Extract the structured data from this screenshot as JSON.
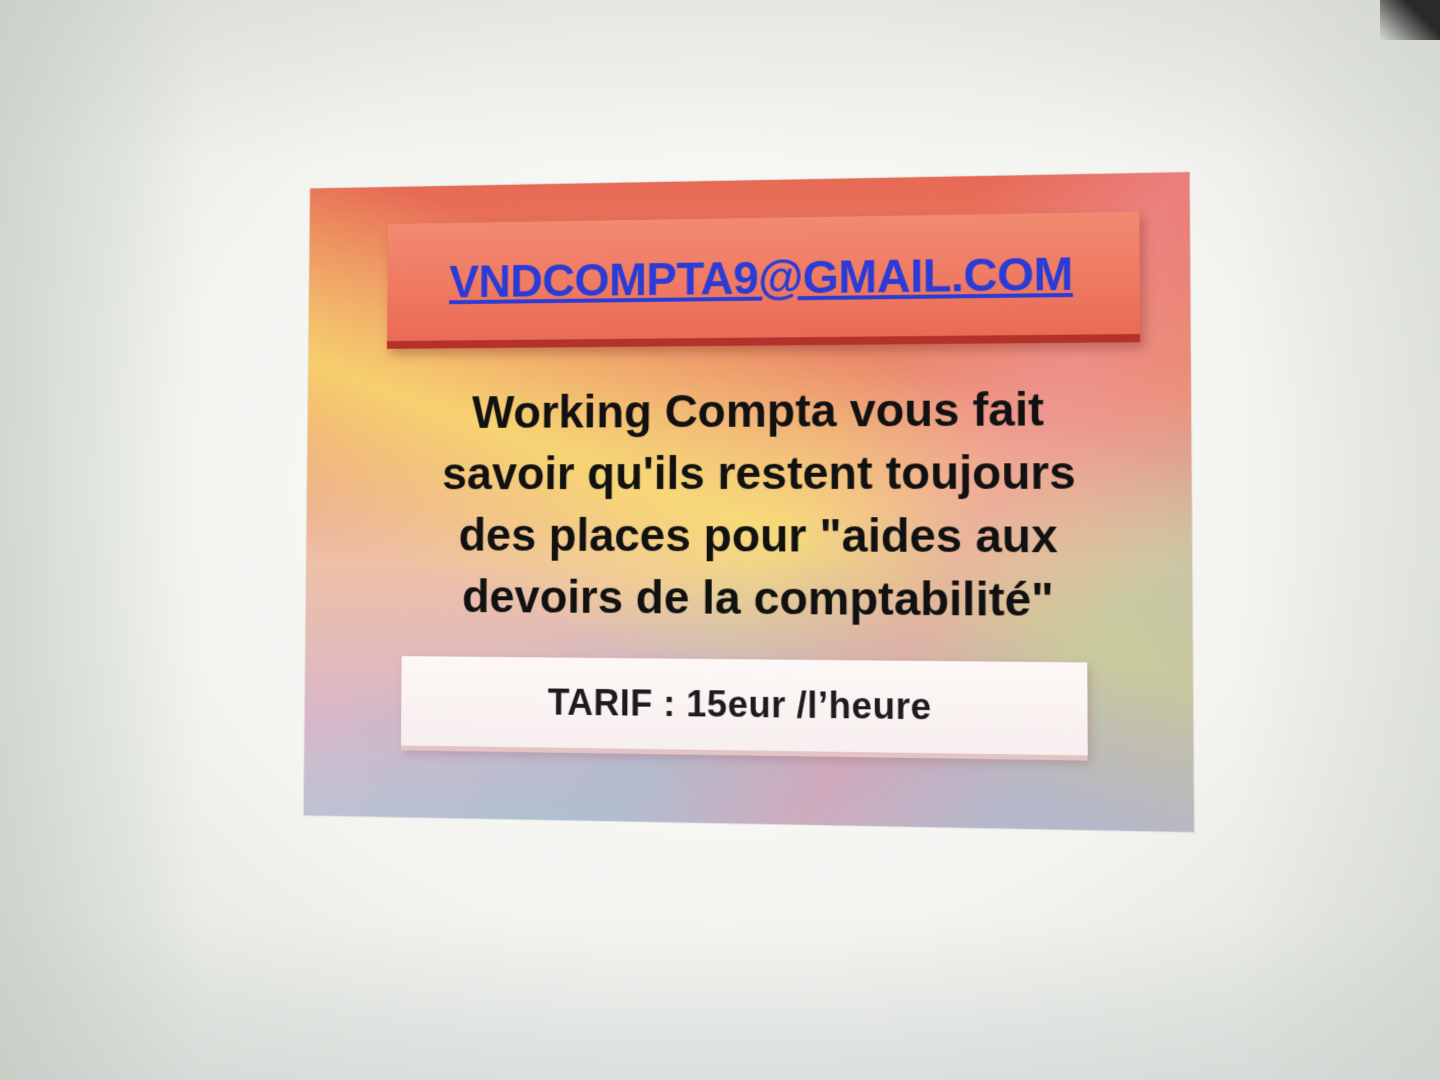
{
  "flyer": {
    "email": "VNDCOMPTA9@GMAIL.COM",
    "message_lines": [
      "Working Compta vous fait",
      "savoir qu'ils restent toujours",
      "des places pour \"aides aux",
      "devoirs de la comptabilité\""
    ],
    "tarif": "TARIF : 15eur /l’heure"
  },
  "colors": {
    "email_text": "#2a3bd6",
    "email_box": "#f07b63",
    "email_box_border": "#b5322a",
    "message_text": "#111111",
    "tarif_box": "#fdf7f6"
  }
}
